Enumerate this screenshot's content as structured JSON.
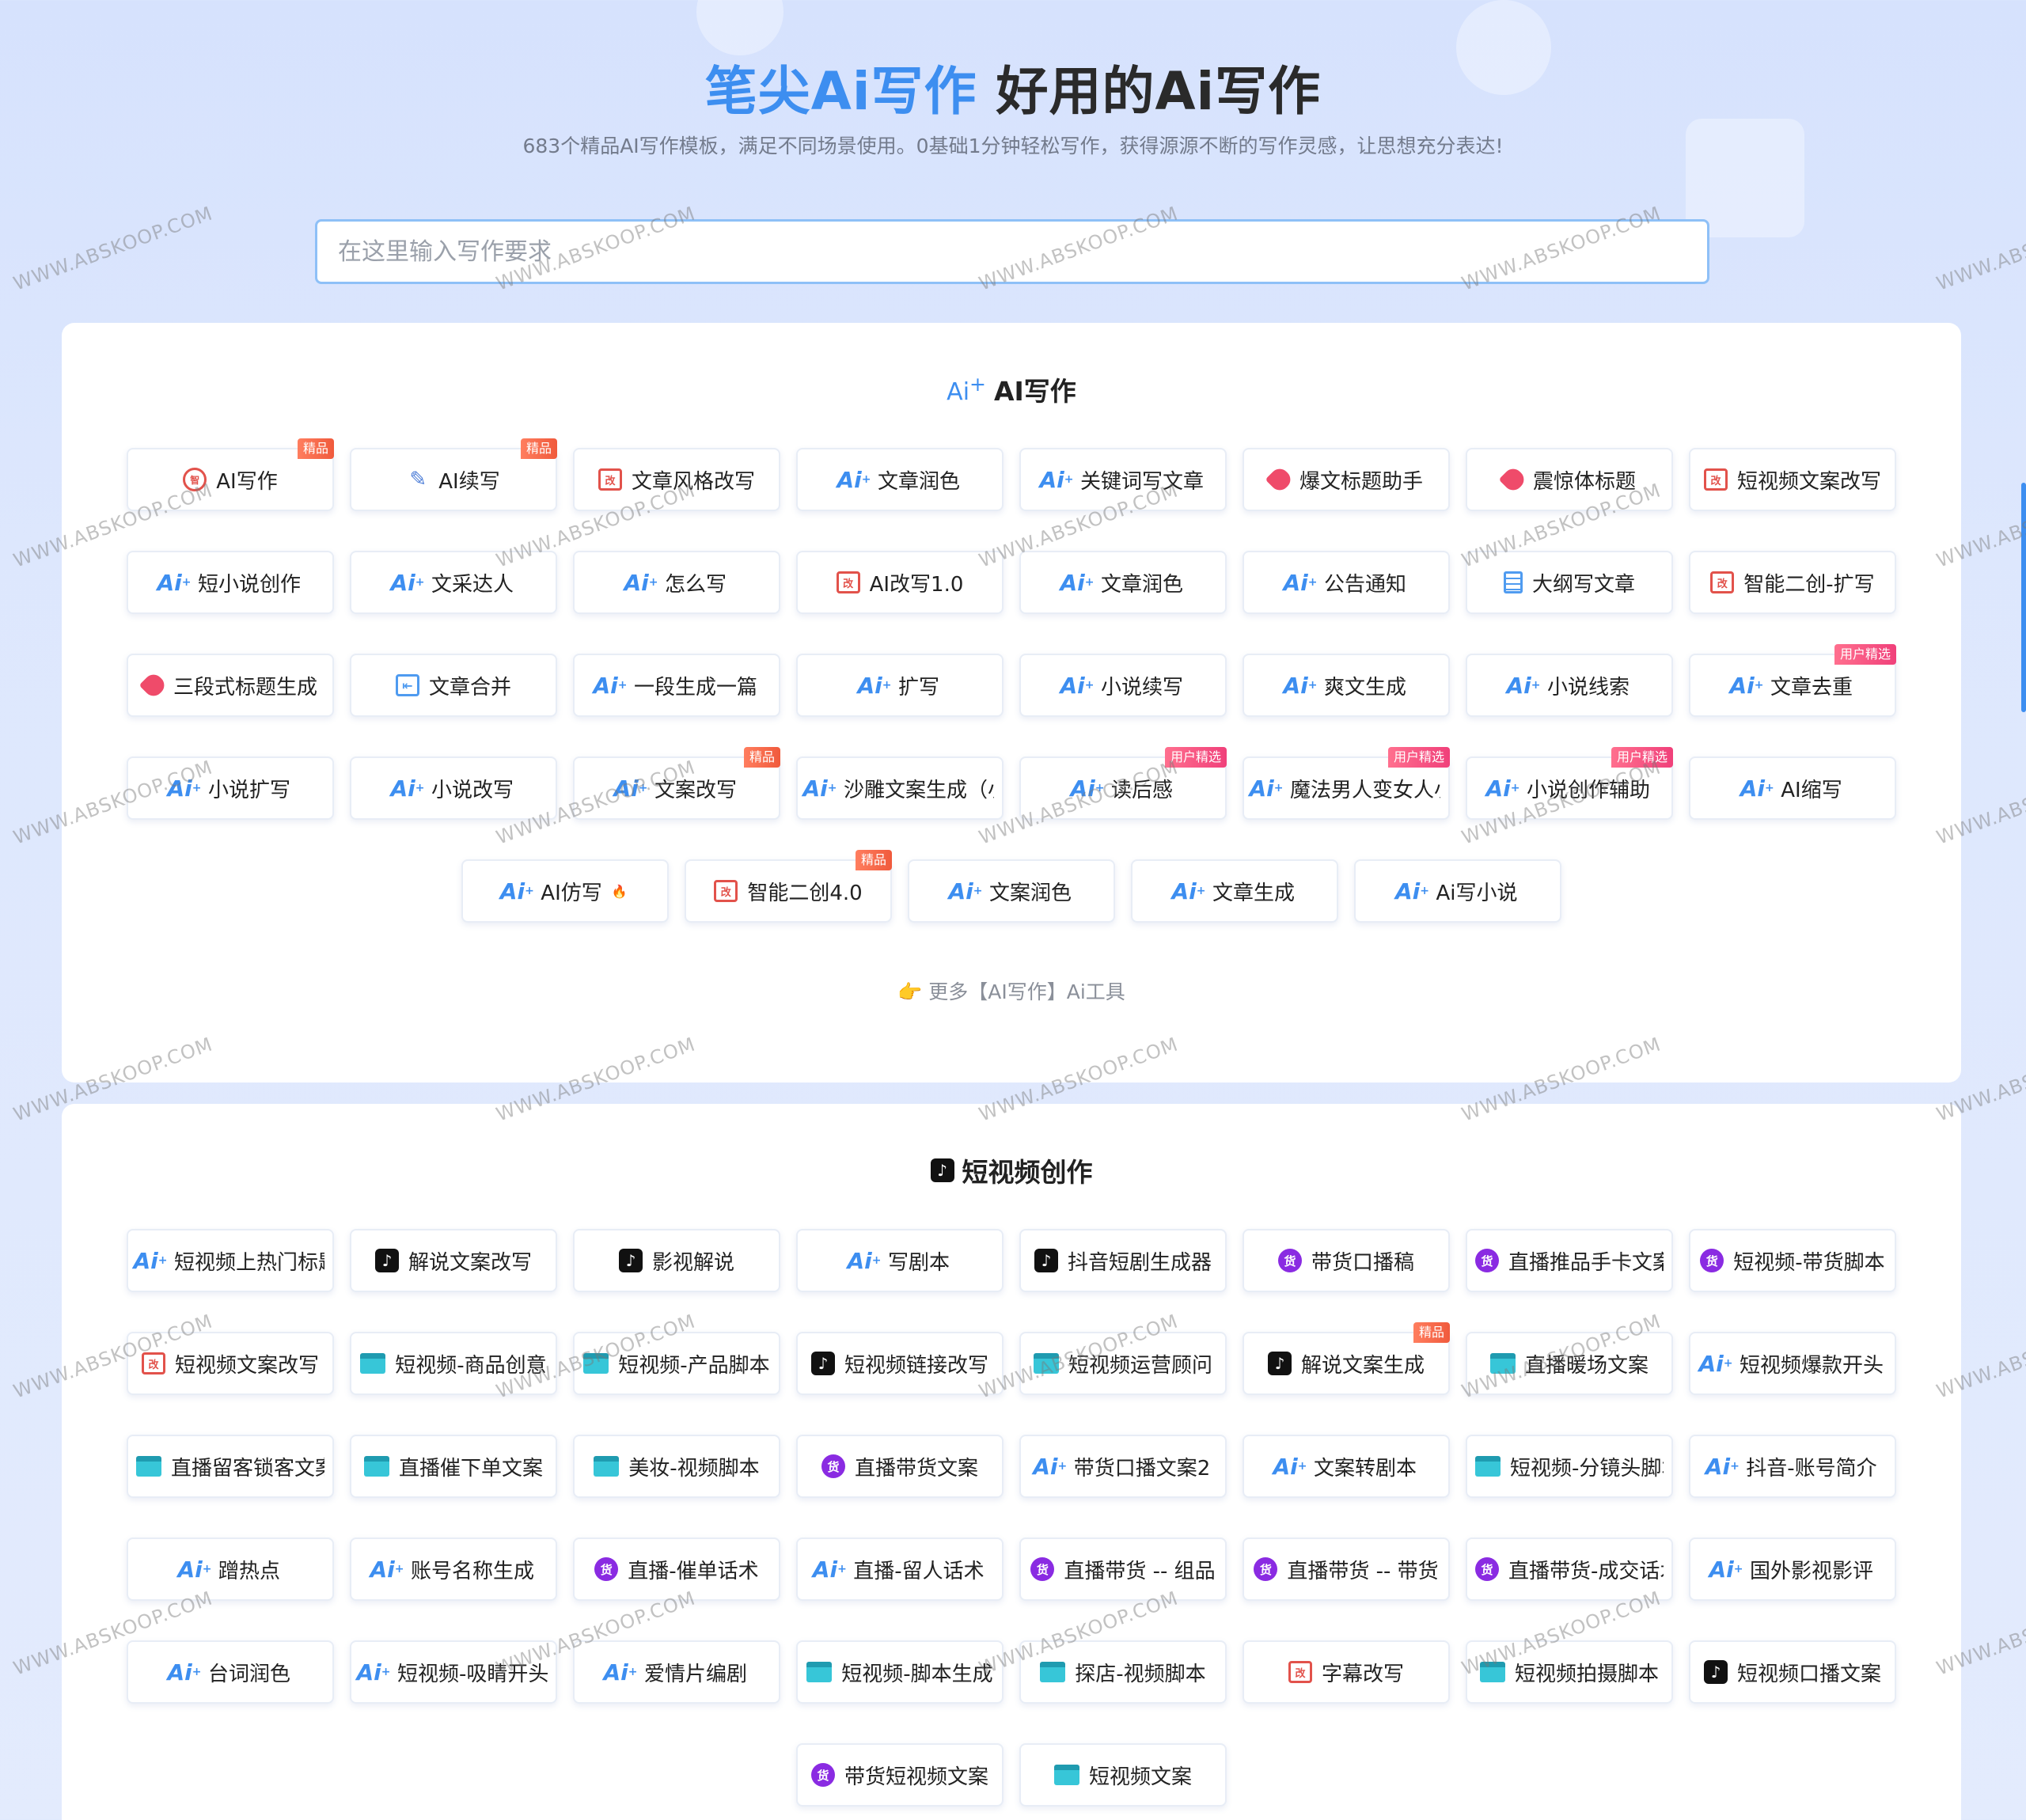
{
  "hero": {
    "title_brand": "笔尖Ai写作",
    "title_rest": " 好用的Ai写作",
    "subtitle": "683个精品AI写作模板，满足不同场景使用。0基础1分钟轻松写作，获得源源不断的写作灵感，让思想充分表达!"
  },
  "search": {
    "placeholder": "在这里输入写作要求",
    "value": ""
  },
  "section1": {
    "title": "AI写作",
    "rows": [
      [
        {
          "label": "AI写作",
          "icon": "zhi",
          "badge": "精品"
        },
        {
          "label": "AI续写",
          "icon": "pen",
          "badge": "精品"
        },
        {
          "label": "文章风格改写",
          "icon": "edit"
        },
        {
          "label": "文章润色",
          "icon": "ai"
        },
        {
          "label": "关键词写文章",
          "icon": "ai"
        },
        {
          "label": "爆文标题助手",
          "icon": "tag"
        },
        {
          "label": "震惊体标题",
          "icon": "tag"
        },
        {
          "label": "短视频文案改写",
          "icon": "edit"
        }
      ],
      [
        {
          "label": "短小说创作",
          "icon": "ai"
        },
        {
          "label": "文采达人",
          "icon": "ai"
        },
        {
          "label": "怎么写",
          "icon": "ai"
        },
        {
          "label": "AI改写1.0",
          "icon": "edit"
        },
        {
          "label": "文章润色",
          "icon": "ai"
        },
        {
          "label": "公告通知",
          "icon": "ai"
        },
        {
          "label": "大纲写文章",
          "icon": "doc"
        },
        {
          "label": "智能二创-扩写",
          "icon": "edit"
        }
      ],
      [
        {
          "label": "三段式标题生成",
          "icon": "tag"
        },
        {
          "label": "文章合并",
          "icon": "merge"
        },
        {
          "label": "一段生成一篇",
          "icon": "ai"
        },
        {
          "label": "扩写",
          "icon": "ai"
        },
        {
          "label": "小说续写",
          "icon": "ai"
        },
        {
          "label": "爽文生成",
          "icon": "ai"
        },
        {
          "label": "小说线索",
          "icon": "ai"
        },
        {
          "label": "文章去重",
          "icon": "ai",
          "badge": "用户精选"
        }
      ],
      [
        {
          "label": "小说扩写",
          "icon": "ai"
        },
        {
          "label": "小说改写",
          "icon": "ai"
        },
        {
          "label": "文案改写",
          "icon": "ai",
          "badge": "精品"
        },
        {
          "label": "沙雕文案生成（小",
          "icon": "ai"
        },
        {
          "label": "读后感",
          "icon": "ai",
          "badge": "用户精选"
        },
        {
          "label": "魔法男人变女人小",
          "icon": "ai",
          "badge": "用户精选"
        },
        {
          "label": "小说创作辅助",
          "icon": "ai",
          "badge": "用户精选"
        },
        {
          "label": "AI缩写",
          "icon": "ai"
        }
      ],
      [
        {
          "label": "AI仿写",
          "icon": "ai",
          "flame": "🔥"
        },
        {
          "label": "智能二创4.0",
          "icon": "edit",
          "badge": "精品"
        },
        {
          "label": "文案润色",
          "icon": "ai"
        },
        {
          "label": "文章生成",
          "icon": "ai"
        },
        {
          "label": "Ai写小说",
          "icon": "ai"
        }
      ]
    ],
    "more": "更多【AI写作】Ai工具"
  },
  "section2": {
    "title": "短视频创作",
    "rows": [
      [
        {
          "label": "短视频上热门标题",
          "icon": "ai"
        },
        {
          "label": "解说文案改写",
          "icon": "tiktok"
        },
        {
          "label": "影视解说",
          "icon": "tiktok"
        },
        {
          "label": "写剧本",
          "icon": "ai"
        },
        {
          "label": "抖音短剧生成器",
          "icon": "tiktok"
        },
        {
          "label": "带货口播稿",
          "icon": "huo"
        },
        {
          "label": "直播推品手卡文案",
          "icon": "huo"
        },
        {
          "label": "短视频-带货脚本",
          "icon": "huo"
        }
      ],
      [
        {
          "label": "短视频文案改写",
          "icon": "edit"
        },
        {
          "label": "短视频-商品创意",
          "icon": "clap"
        },
        {
          "label": "短视频-产品脚本",
          "icon": "clap"
        },
        {
          "label": "短视频链接改写",
          "icon": "tiktok"
        },
        {
          "label": "短视频运营顾问",
          "icon": "clap"
        },
        {
          "label": "解说文案生成",
          "icon": "tiktok",
          "badge": "精品"
        },
        {
          "label": "直播暖场文案",
          "icon": "clap"
        },
        {
          "label": "短视频爆款开头",
          "icon": "ai"
        }
      ],
      [
        {
          "label": "直播留客锁客文案",
          "icon": "clap"
        },
        {
          "label": "直播催下单文案",
          "icon": "clap"
        },
        {
          "label": "美妆-视频脚本",
          "icon": "clap"
        },
        {
          "label": "直播带货文案",
          "icon": "huo"
        },
        {
          "label": "带货口播文案2",
          "icon": "ai"
        },
        {
          "label": "文案转剧本",
          "icon": "ai"
        },
        {
          "label": "短视频-分镜头脚本",
          "icon": "clap"
        },
        {
          "label": "抖音-账号简介",
          "icon": "ai"
        }
      ],
      [
        {
          "label": "蹭热点",
          "icon": "ai"
        },
        {
          "label": "账号名称生成",
          "icon": "ai"
        },
        {
          "label": "直播-催单话术",
          "icon": "huo"
        },
        {
          "label": "直播-留人话术",
          "icon": "ai"
        },
        {
          "label": "直播带货 -- 组品",
          "icon": "huo"
        },
        {
          "label": "直播带货 -- 带货",
          "icon": "huo"
        },
        {
          "label": "直播带货-成交话术",
          "icon": "huo"
        },
        {
          "label": "国外影视影评",
          "icon": "ai"
        }
      ],
      [
        {
          "label": "台词润色",
          "icon": "ai"
        },
        {
          "label": "短视频-吸睛开头",
          "icon": "ai"
        },
        {
          "label": "爱情片编剧",
          "icon": "ai"
        },
        {
          "label": "短视频-脚本生成",
          "icon": "clap"
        },
        {
          "label": "探店-视频脚本",
          "icon": "clap"
        },
        {
          "label": "字幕改写",
          "icon": "edit"
        },
        {
          "label": "短视频拍摄脚本",
          "icon": "clap"
        },
        {
          "label": "短视频口播文案",
          "icon": "tiktok"
        }
      ],
      [
        {
          "label": "带货短视频文案",
          "icon": "huo"
        },
        {
          "label": "短视频文案",
          "icon": "clap"
        }
      ]
    ]
  },
  "watermark": "WWW.ABSKOOP.COM",
  "colors": {
    "brand": "#3d8ef0",
    "badge": "#f05a3c",
    "panel": "#ffffff"
  }
}
